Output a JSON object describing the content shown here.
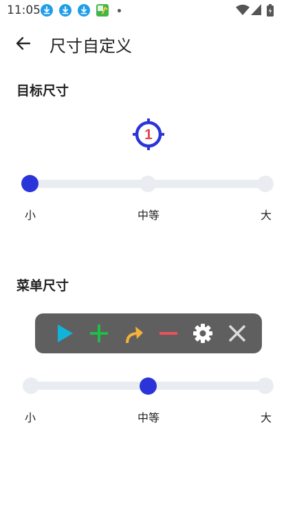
{
  "status_bar": {
    "time": "11:05",
    "icons": [
      "download-icon",
      "download-icon",
      "download-icon",
      "app-notification-icon",
      "more-dot-icon",
      "wifi-icon",
      "signal-icon",
      "battery-icon"
    ]
  },
  "app_bar": {
    "title": "尺寸自定义",
    "back_icon": "arrow-left-icon"
  },
  "target_section": {
    "title": "目标尺寸",
    "preview_icon": "crosshair-target-icon",
    "preview_number": "1",
    "slider": {
      "labels": [
        "小",
        "中等",
        "大"
      ],
      "selected_index": 0
    }
  },
  "menu_section": {
    "title": "菜单尺寸",
    "preview_icons": [
      "play-icon",
      "plus-icon",
      "redirect-arrow-icon",
      "minus-icon",
      "gear-icon",
      "close-icon"
    ],
    "slider": {
      "labels": [
        "小",
        "中等",
        "大"
      ],
      "selected_index": 1
    }
  },
  "colors": {
    "accent": "#2a34d8",
    "track": "#e9edf2",
    "menu_bg": "#5f5f5f",
    "play": "#12b3d8",
    "plus": "#1fbe46",
    "redirect": "#f4b23a",
    "minus": "#f0505a",
    "target_red": "#e0444f"
  }
}
